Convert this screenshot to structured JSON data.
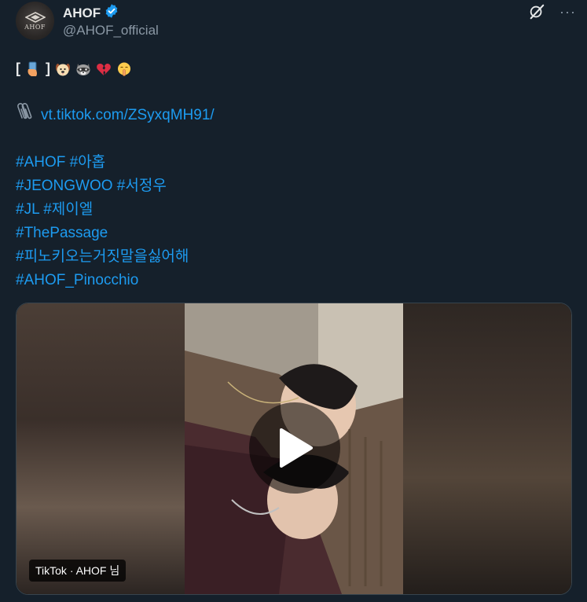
{
  "author": {
    "display_name": "AHOF",
    "handle": "@AHOF_official",
    "avatar_text": "AHOF",
    "verified": true
  },
  "header_icons": {
    "grok": "grok-slash-icon",
    "more": "···"
  },
  "tweet": {
    "emoji_line": {
      "open_bracket": "[",
      "close_bracket": "]",
      "icons": [
        "selfie-hand-icon",
        "puppy-face-icon",
        "raccoon-face-icon",
        "broken-heart-icon",
        "shushing-face-icon"
      ]
    },
    "link": "vt.tiktok.com/ZSyxqMH91/",
    "hashtag_lines": [
      "#AHOF #아홉",
      "#JEONGWOO #서정우",
      "#JL #제이엘",
      "#ThePassage",
      "#피노키오는거짓말을싫어해",
      "#AHOF_Pinocchio"
    ]
  },
  "media": {
    "label": "TikTok · AHOF 님",
    "play_icon": "play-icon"
  },
  "colors": {
    "background": "#15202b",
    "accent": "#1d9bf0",
    "verified": "#1d9bf0",
    "secondary_text": "#8b98a5",
    "border": "#38444d"
  }
}
